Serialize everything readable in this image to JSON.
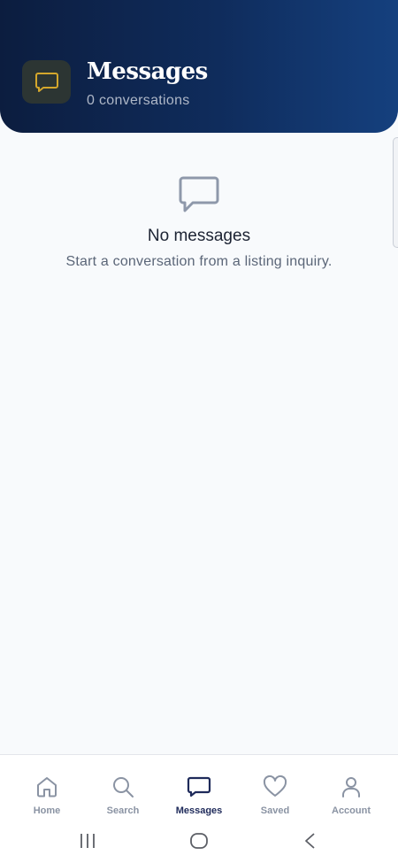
{
  "header": {
    "title": "Messages",
    "subtitle": "0 conversations",
    "icon": "chat-bubble-icon",
    "icon_color": "#d4a72c"
  },
  "empty_state": {
    "icon": "chat-bubble-icon",
    "title": "No messages",
    "subtitle": "Start a conversation from a listing inquiry."
  },
  "bottom_nav": {
    "active": "Messages",
    "active_color": "#1e2a5a",
    "inactive_color": "#8a93a3",
    "items": [
      {
        "label": "Home",
        "icon": "home-icon"
      },
      {
        "label": "Search",
        "icon": "search-icon"
      },
      {
        "label": "Messages",
        "icon": "chat-bubble-icon"
      },
      {
        "label": "Saved",
        "icon": "heart-icon"
      },
      {
        "label": "Account",
        "icon": "user-icon"
      }
    ]
  },
  "system_nav": {
    "items": [
      "recent-apps-icon",
      "home-circle-icon",
      "back-icon"
    ]
  }
}
